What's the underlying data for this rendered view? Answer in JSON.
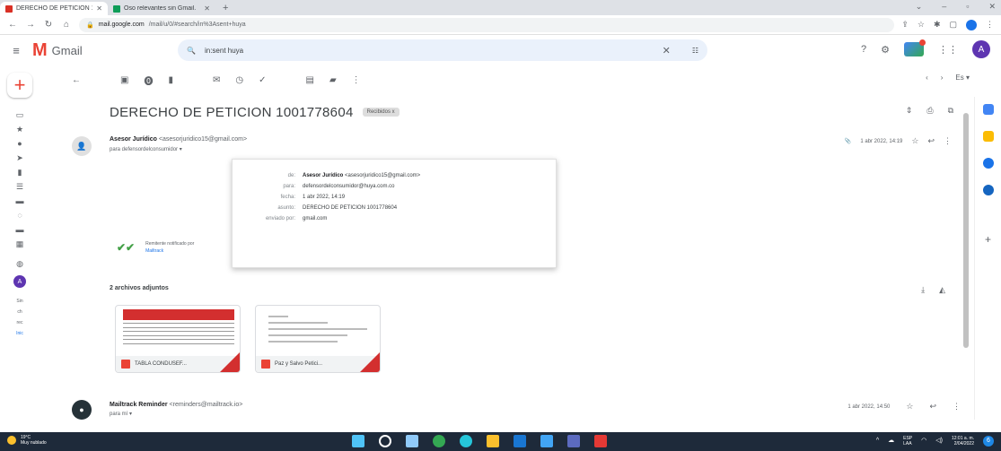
{
  "browser": {
    "tabs": [
      {
        "title": "DERECHO DE PETICION 100177...",
        "fav": "#d93025"
      },
      {
        "title": "Oso relevantes sin Gmail.",
        "fav": "#0f9d58"
      }
    ],
    "url_host": "mail.google.com",
    "url_rest": "/mail/u/0/#search/in%3Asent+huya"
  },
  "gmail": {
    "app_name": "Gmail",
    "search_value": "in:sent huya",
    "account_initial": "A"
  },
  "message": {
    "subject": "DERECHO DE PETICION 1001778604",
    "label": "Recibidos x",
    "sender_name": "Asesor Jurídico",
    "sender_email": "<asesorjuridico15@gmail.com>",
    "to_line": "para defensordelconsumidor ▾",
    "date_short": "1 abr 2022, 14:19",
    "details": [
      {
        "k": "de:",
        "v": "Asesor Jurídico",
        "v2": " <asesorjuridico15@gmail.com>"
      },
      {
        "k": "para:",
        "v": "defensordelconsumidor@huya.com.co",
        "v2": ""
      },
      {
        "k": "fecha:",
        "v": "1 abr 2022, 14:19",
        "v2": ""
      },
      {
        "k": "asunto:",
        "v": "DERECHO DE PETICION 1001778604",
        "v2": ""
      },
      {
        "k": "enviado por:",
        "v": "gmail.com",
        "v2": ""
      }
    ],
    "tracker_text": "Remitente notificado por",
    "tracker_link": "Mailtrack",
    "attachments_title": "2 archivos adjuntos",
    "attachments": [
      {
        "name": "TABLA CONDUSEF..."
      },
      {
        "name": "Paz y Salvo Petici..."
      }
    ],
    "reply_sender": "Mailtrack Reminder",
    "reply_sender_email": "<reminders@mailtrack.io>",
    "reply_to": "para mí ▾",
    "reply_date": "1 abr 2022, 14:50"
  },
  "rail": {
    "compose_icon": "plus-icon",
    "note_text": [
      "Sin",
      "ch",
      "rec",
      "Inic"
    ],
    "note_link": "Inic"
  },
  "taskbar": {
    "weather_temp": "19°C",
    "weather_desc": "Muy nublado",
    "lang": "ESP",
    "lang2": "LAA",
    "time": "12:01 a. m.",
    "date": "2/04/2022",
    "notif_count": "6"
  },
  "colors": {
    "gmail_red": "#ea4335",
    "chrome_blue": "#1a73e8",
    "taskbar": "#1e2a3a"
  }
}
